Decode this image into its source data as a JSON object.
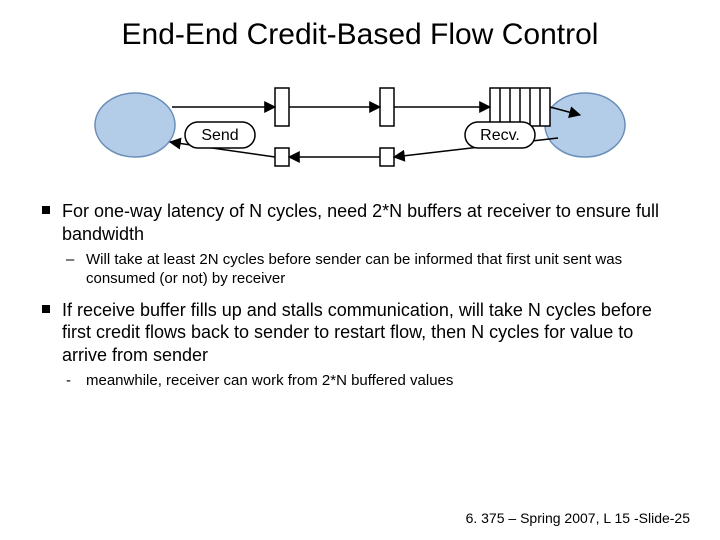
{
  "title": "End-End Credit-Based Flow Control",
  "diagram": {
    "send_label": "Send",
    "recv_label": "Recv."
  },
  "bullets": [
    {
      "text": "For one-way latency of N cycles, need 2*N buffers at receiver to ensure full bandwidth",
      "sub": [
        {
          "style": "dash",
          "text": "Will take at least 2N cycles before sender can be informed that first unit sent was consumed (or not) by receiver"
        }
      ]
    },
    {
      "text": "If receive buffer fills up and stalls communication, will take N cycles before first credit flows back to sender to restart flow, then N cycles for value to arrive from sender",
      "sub": [
        {
          "style": "hyphen",
          "text": "meanwhile, receiver can work from 2*N buffered values"
        }
      ]
    }
  ],
  "footer": "6. 375 – Spring 2007, L 15 -Slide-25"
}
